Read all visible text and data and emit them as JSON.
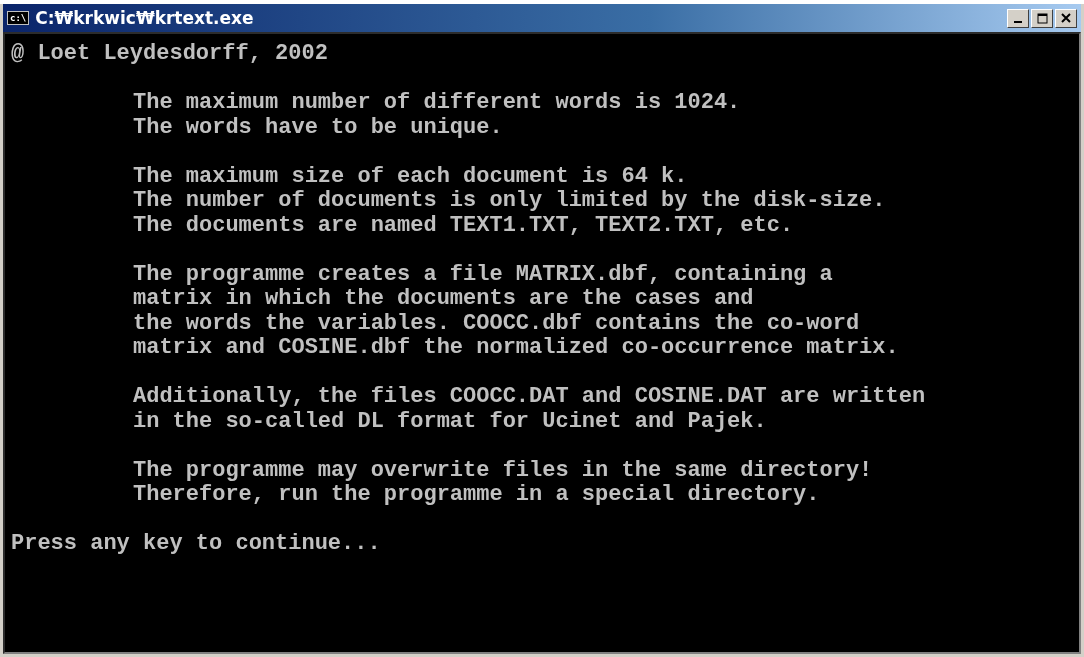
{
  "window": {
    "title": "C:₩krkwic₩krtext.exe",
    "icon_text": "c:\\"
  },
  "console": {
    "blocks": [
      {
        "kind": "plain",
        "lines": [
          "@ Loet Leydesdorff, 2002"
        ]
      },
      {
        "kind": "indented",
        "lines": [
          "The maximum number of different words is 1024.",
          "The words have to be unique."
        ]
      },
      {
        "kind": "indented",
        "lines": [
          "The maximum size of each document is 64 k.",
          "The number of documents is only limited by the disk-size.",
          "The documents are named TEXT1.TXT, TEXT2.TXT, etc."
        ]
      },
      {
        "kind": "indented",
        "lines": [
          "The programme creates a file MATRIX.dbf, containing a",
          "matrix in which the documents are the cases and",
          "the words the variables. COOCC.dbf contains the co-word",
          "matrix and COSINE.dbf the normalized co-occurrence matrix."
        ]
      },
      {
        "kind": "indented",
        "lines": [
          "Additionally, the files COOCC.DAT and COSINE.DAT are written",
          "in the so-called DL format for Ucinet and Pajek."
        ]
      },
      {
        "kind": "indented",
        "lines": [
          "The programme may overwrite files in the same directory!",
          "Therefore, run the programme in a special directory."
        ]
      },
      {
        "kind": "plain",
        "lines": [
          "Press any key to continue..."
        ]
      }
    ]
  }
}
